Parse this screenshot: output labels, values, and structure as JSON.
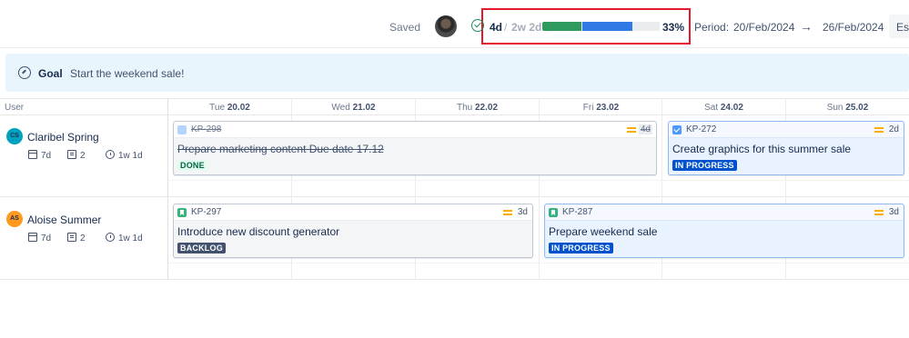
{
  "header": {
    "saved_label": "Saved",
    "estimate": {
      "done": "4d",
      "separator": "/",
      "total": "2w 2d",
      "progress_percent_label": "33%",
      "done_fraction": 0.33,
      "in_progress_fraction": 0.43
    },
    "period": {
      "label": "Period:",
      "start": "20/Feb/2024",
      "end": "26/Feb/2024"
    },
    "est_button_label": "Est"
  },
  "goal": {
    "label": "Goal",
    "text": "Start the weekend sale!"
  },
  "grid": {
    "user_column_header": "User",
    "days": [
      {
        "weekday": "Tue",
        "date": "20.02"
      },
      {
        "weekday": "Wed",
        "date": "21.02"
      },
      {
        "weekday": "Thu",
        "date": "22.02"
      },
      {
        "weekday": "Fri",
        "date": "23.02"
      },
      {
        "weekday": "Sat",
        "date": "24.02"
      },
      {
        "weekday": "Sun",
        "date": "25.02"
      }
    ]
  },
  "users": [
    {
      "initials": "CS",
      "name": "Claribel Spring",
      "avatar_color": "#00a3bf",
      "stats": {
        "days": "7d",
        "issues": "2",
        "time": "1w 1d"
      }
    },
    {
      "initials": "AS",
      "name": "Aloise Summer",
      "avatar_color": "#ff991f",
      "stats": {
        "days": "7d",
        "issues": "2",
        "time": "1w 1d"
      }
    }
  ],
  "cards": [
    {
      "key": "KP-298",
      "title": "Prepare marketing content Due date 17.12",
      "estimate": "4d",
      "status": "DONE",
      "type_icon": "task-icon",
      "done": true
    },
    {
      "key": "KP-272",
      "title": "Create graphics for this summer sale",
      "estimate": "2d",
      "status": "IN PROGRESS",
      "type_icon": "task-icon",
      "done": false
    },
    {
      "key": "KP-297",
      "title": "Introduce new discount generator",
      "estimate": "3d",
      "status": "BACKLOG",
      "type_icon": "story-icon",
      "done": false
    },
    {
      "key": "KP-287",
      "title": "Prepare weekend sale",
      "estimate": "3d",
      "status": "IN PROGRESS",
      "type_icon": "story-icon",
      "done": false
    }
  ],
  "colors": {
    "progress_done": "#2e9a5e",
    "progress_in_progress": "#2f7ae5",
    "goal_background": "#e9f5fc",
    "status_in_progress": "#0052cc",
    "status_backlog": "#42526e",
    "status_done": "#006644",
    "highlight": "#e5192b"
  }
}
